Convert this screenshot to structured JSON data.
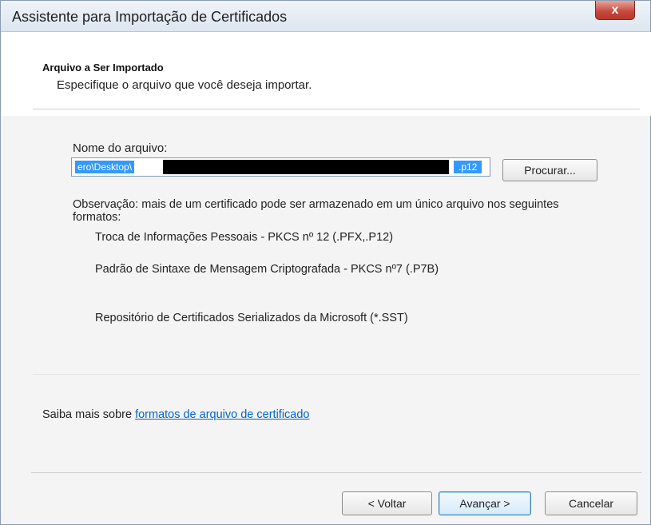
{
  "window": {
    "title": "Assistente para Importação de Certificados",
    "close_label": "x"
  },
  "header": {
    "section_title": "Arquivo a Ser Importado",
    "description": "Especifique o arquivo que você deseja importar."
  },
  "file": {
    "label": "Nome do arquivo:",
    "value_start": "ero\\Desktop\\",
    "value_end": ".p12",
    "browse_label": "Procurar..."
  },
  "note": {
    "text": "Observação: mais de um certificado pode ser armazenado em um único arquivo nos seguintes formatos:",
    "formats": [
      "Troca de Informações Pessoais - PKCS nº 12 (.PFX,.P12)",
      "Padrão de Sintaxe de Mensagem Criptografada - PKCS nº7 (.P7B)",
      "Repositório de Certificados Serializados da Microsoft (*.SST)"
    ]
  },
  "learn_more": {
    "prefix": "Saiba mais sobre ",
    "link": "formatos de arquivo de certificado"
  },
  "buttons": {
    "back": "< Voltar",
    "next": "Avançar >",
    "cancel": "Cancelar"
  },
  "colors": {
    "selection": "#3399ff",
    "link": "#0066cc",
    "close_button": "#c6463a",
    "redaction": "#000000"
  }
}
